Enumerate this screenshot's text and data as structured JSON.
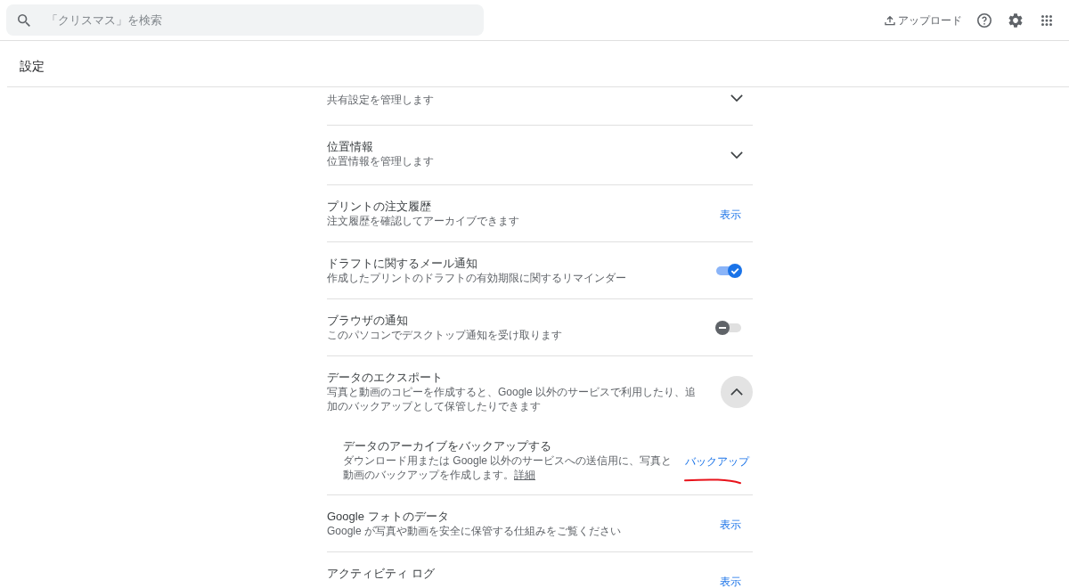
{
  "header": {
    "search": {
      "placeholder": "「クリスマス」を検索"
    },
    "upload_label": "アップロード"
  },
  "page_title": "設定",
  "settings": [
    {
      "kind": "expand",
      "description": "共有設定を管理します",
      "expanded": false
    },
    {
      "kind": "expand",
      "title": "位置情報",
      "description": "位置情報を管理します",
      "expanded": false
    },
    {
      "kind": "link",
      "title": "プリントの注文履歴",
      "description": "注文履歴を確認してアーカイブできます",
      "action": "表示"
    },
    {
      "kind": "toggle",
      "title": "ドラフトに関するメール通知",
      "description": "作成したプリントのドラフトの有効期限に関するリマインダー",
      "on": true
    },
    {
      "kind": "toggle",
      "title": "ブラウザの通知",
      "description": "このパソコンでデスクトップ通知を受け取ります",
      "on": false
    },
    {
      "kind": "expand",
      "title": "データのエクスポート",
      "description": "写真と動画のコピーを作成すると、Google 以外のサービスで利用したり、追加のバックアップとして保管したりできます",
      "expanded": true,
      "children": [
        {
          "kind": "link",
          "title": "データのアーカイブをバックアップする",
          "description": "ダウンロード用または Google 以外のサービスへの送信用に、写真と動画のバックアップを作成します。",
          "more_link": "詳細",
          "action": "バックアップ",
          "annotated": true
        }
      ]
    },
    {
      "kind": "link",
      "title": "Google フォトのデータ",
      "description": "Google が写真や動画を安全に保管する仕組みをご覧ください",
      "action": "表示"
    },
    {
      "kind": "link",
      "title": "アクティビティ ログ",
      "action": "表示"
    }
  ]
}
